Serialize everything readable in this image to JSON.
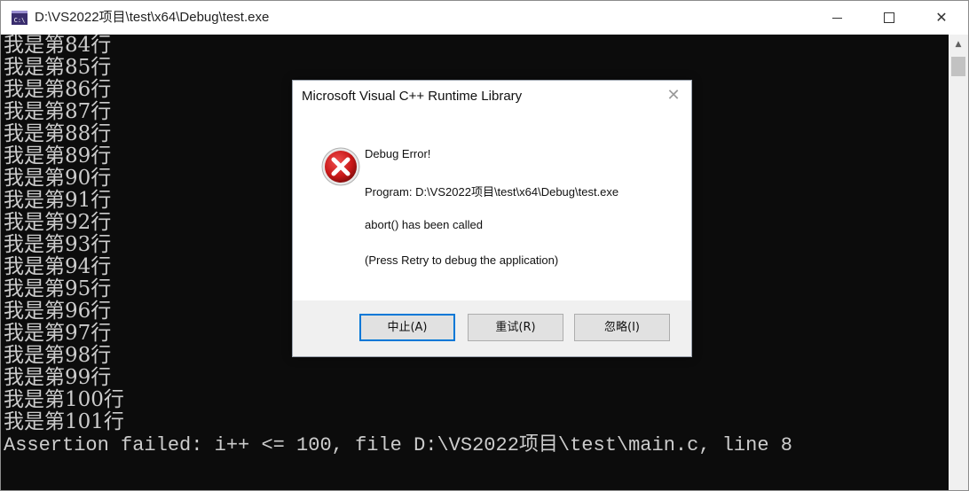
{
  "window": {
    "title": "D:\\VS2022项目\\test\\x64\\Debug\\test.exe",
    "icon": "console-app-icon",
    "icon_text": "C:\\",
    "controls": {
      "minimize_icon": "minimize-icon",
      "maximize_icon": "maximize-icon",
      "close_glyph": "✕"
    }
  },
  "console": {
    "background": "#0c0c0c",
    "text_color": "#cccccc",
    "lines": [
      "我是第84行",
      "我是第85行",
      "我是第86行",
      "我是第87行",
      "我是第88行",
      "我是第89行",
      "我是第90行",
      "我是第91行",
      "我是第92行",
      "我是第93行",
      "我是第94行",
      "我是第95行",
      "我是第96行",
      "我是第97行",
      "我是第98行",
      "我是第99行",
      "我是第100行",
      "我是第101行"
    ],
    "assertion": "Assertion failed: i++ <= 100, file D:\\VS2022项目\\test\\main.c, line 8"
  },
  "scrollbar": {
    "up_glyph": "▲"
  },
  "dialog": {
    "title": "Microsoft Visual C++ Runtime Library",
    "close_glyph": "✕",
    "icon": "error-icon",
    "error_color": "#d11a1a",
    "heading": "Debug Error!",
    "program": "Program: D:\\VS2022项目\\test\\x64\\Debug\\test.exe",
    "message": "abort() has been called",
    "hint": "(Press Retry to debug the application)",
    "buttons": {
      "abort": "中止(A)",
      "retry": "重试(R)",
      "ignore": "忽略(I)"
    },
    "accent": "#0078d7"
  }
}
